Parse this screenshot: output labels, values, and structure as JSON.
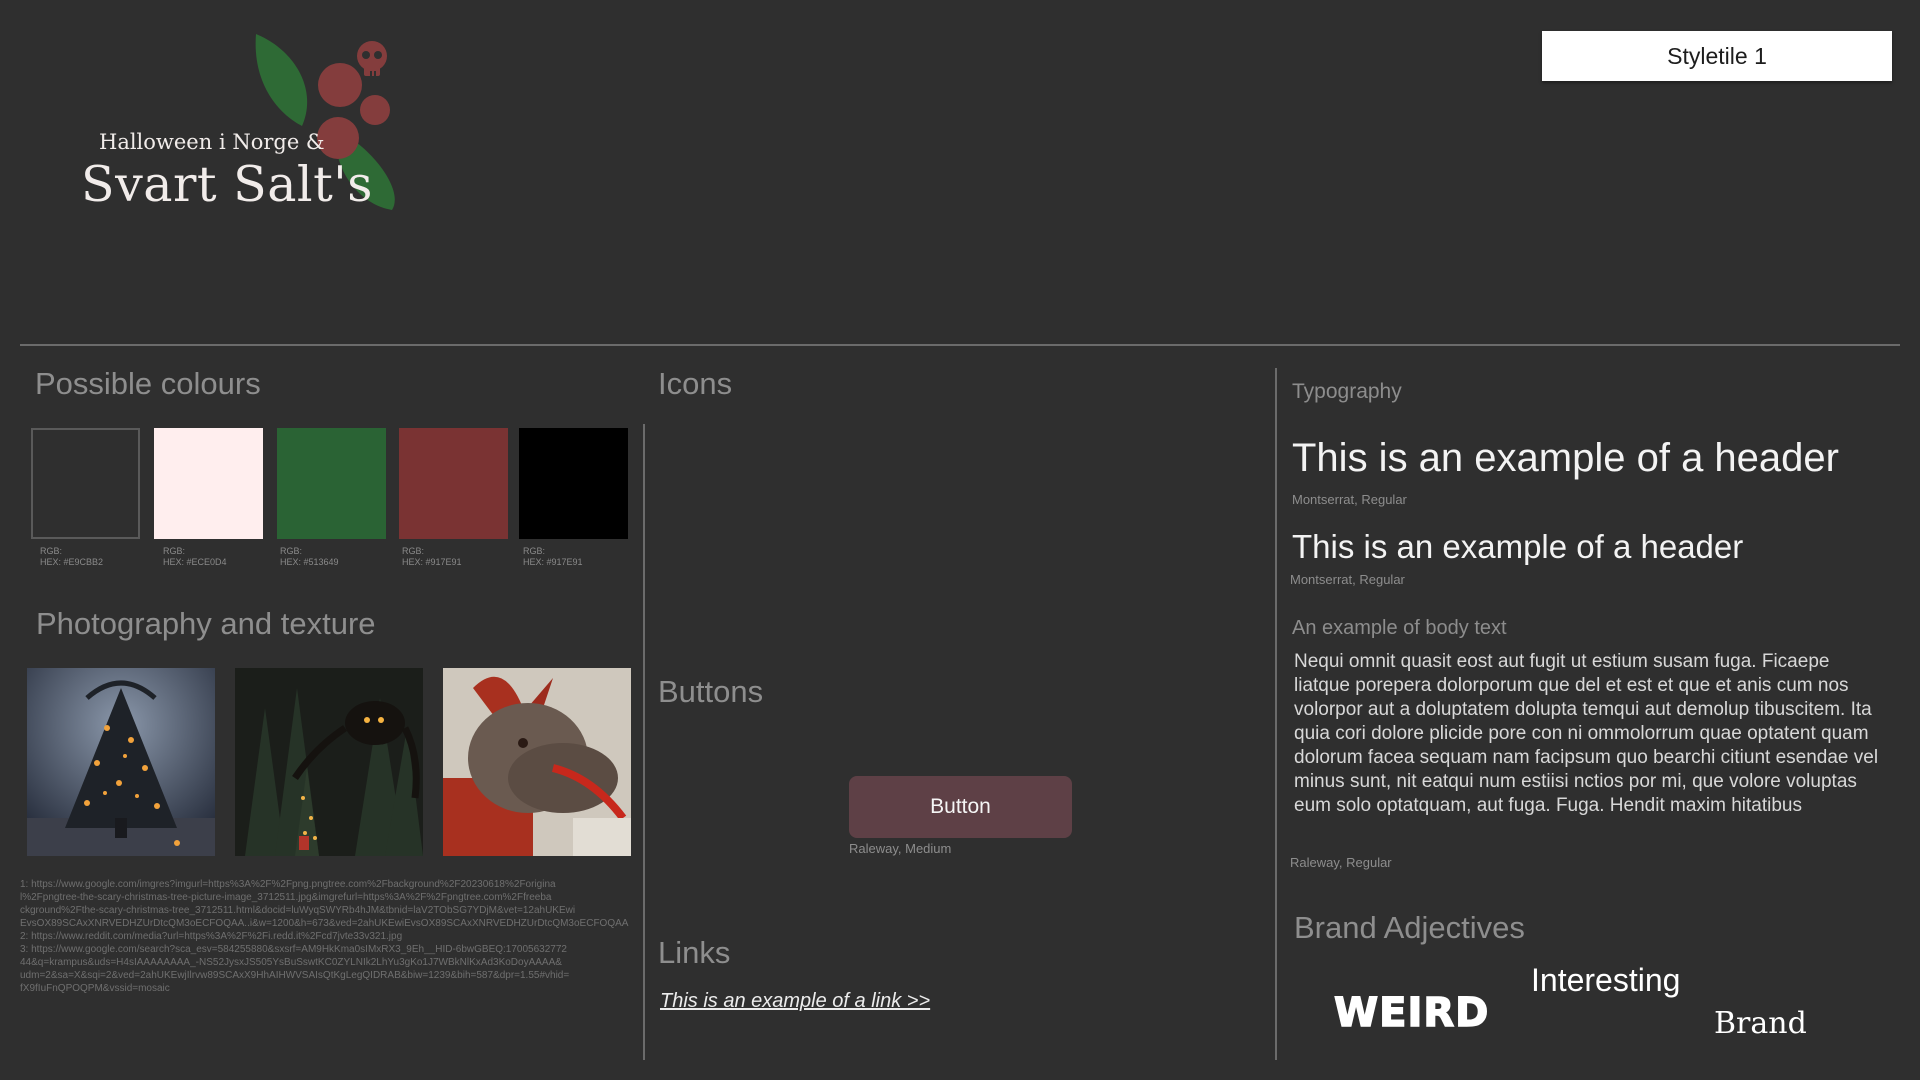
{
  "logo": {
    "line1": "Halloween i Norge &",
    "line2": "Svart Salt's"
  },
  "badge": "Styletile 1",
  "colours": {
    "title": "Possible colours",
    "swatches": [
      {
        "fill": "#2f2f2f",
        "rgb": "RGB:",
        "hex": "HEX: #E9CBB2"
      },
      {
        "fill": "#ffeeee",
        "rgb": "RGB:",
        "hex": "HEX: #ECE0D4"
      },
      {
        "fill": "#2a6334",
        "rgb": "RGB:",
        "hex": "HEX: #513649"
      },
      {
        "fill": "#7a3333",
        "rgb": "RGB:",
        "hex": "HEX: #917E91"
      },
      {
        "fill": "#000000",
        "rgb": "RGB:",
        "hex": "HEX: #917E91"
      }
    ]
  },
  "photography": {
    "title": "Photography and texture",
    "references": [
      "1: https://www.google.com/imgres?imgurl=https%3A%2F%2Fpng.pngtree.com%2Fbackground%2F20230618%2Forigina",
      "l%2Fpngtree-the-scary-christmas-tree-picture-image_3712511.jpg&imgrefurl=https%3A%2F%2Fpngtree.com%2Ffreeba",
      "ckground%2Fthe-scary-christmas-tree_3712511.html&docid=luWyqSWYRb4hJM&tbnid=laV2TObSG7YDjM&vet=12ahUKEwi",
      "EvsOX89SCAxXNRVEDHZUrDtcQM3oECFOQAA..i&w=1200&h=673&ved=2ahUKEwiEvsOX89SCAxXNRVEDHZUrDtcQM3oECFOQAA",
      "2: https://www.reddit.com/media?url=https%3A%2F%2Fi.redd.it%2Fcd7jvte33v321.jpg",
      "3: https://www.google.com/search?sca_esv=584255880&sxsrf=AM9HkKma0sIMxRX3_9Eh__HID-6bwGBEQ:17005632772",
      "44&q=krampus&uds=H4sIAAAAAAAA_-NS52JysxJS505YsBuSswtKC0ZYLNIk2LhYu3gKo1J7WBkNlKxAd3KoDoyAAAA&",
      "udm=2&sa=X&sqi=2&ved=2ahUKEwjIlrvw89SCAxX9HhAIHWVSAIsQtKgLegQIDRAB&biw=1239&bih=587&dpr=1.55#vhid=",
      "fX9fIuFnQPOQPM&vssid=mosaic"
    ]
  },
  "icons": {
    "title": "Icons"
  },
  "buttons": {
    "title": "Buttons",
    "label": "Button",
    "font": "Raleway, Medium"
  },
  "links": {
    "title": "Links",
    "text": "This is an example of a link >>"
  },
  "typography": {
    "title": "Typography",
    "header1": "This is an example of a header",
    "header1_font": "Montserrat, Regular",
    "header2": "This is an example of a header",
    "header2_font": "Montserrat, Regular",
    "body_label": "An example of body text",
    "body": "Nequi omnit quasit eost aut fugit ut estium susam fuga. Ficaepe liatque porepera dolorporum que del et est et que et anis cum nos volorpor aut a doluptatem dolupta temqui aut demolup tibuscitem. Ita quia cori dolore plicide pore con ni ommolorrum quae optatent quam dolorum facea sequam nam facipsum quo bearchi citiunt esendae vel minus sunt, nit eatqui num estiisi nctios por mi, que volore voluptas eum solo optatquam, aut fuga. Fuga. Hendit maxim hitatibus",
    "body_font": "Raleway, Regular"
  },
  "adjectives": {
    "title": "Brand Adjectives",
    "words": [
      "WEIRD",
      "Interesting",
      "Brand"
    ]
  },
  "colors": {
    "background": "#2f2f2f",
    "button": "#5e4046",
    "berry": "#843d3d",
    "leaf": "#2e6a35"
  }
}
